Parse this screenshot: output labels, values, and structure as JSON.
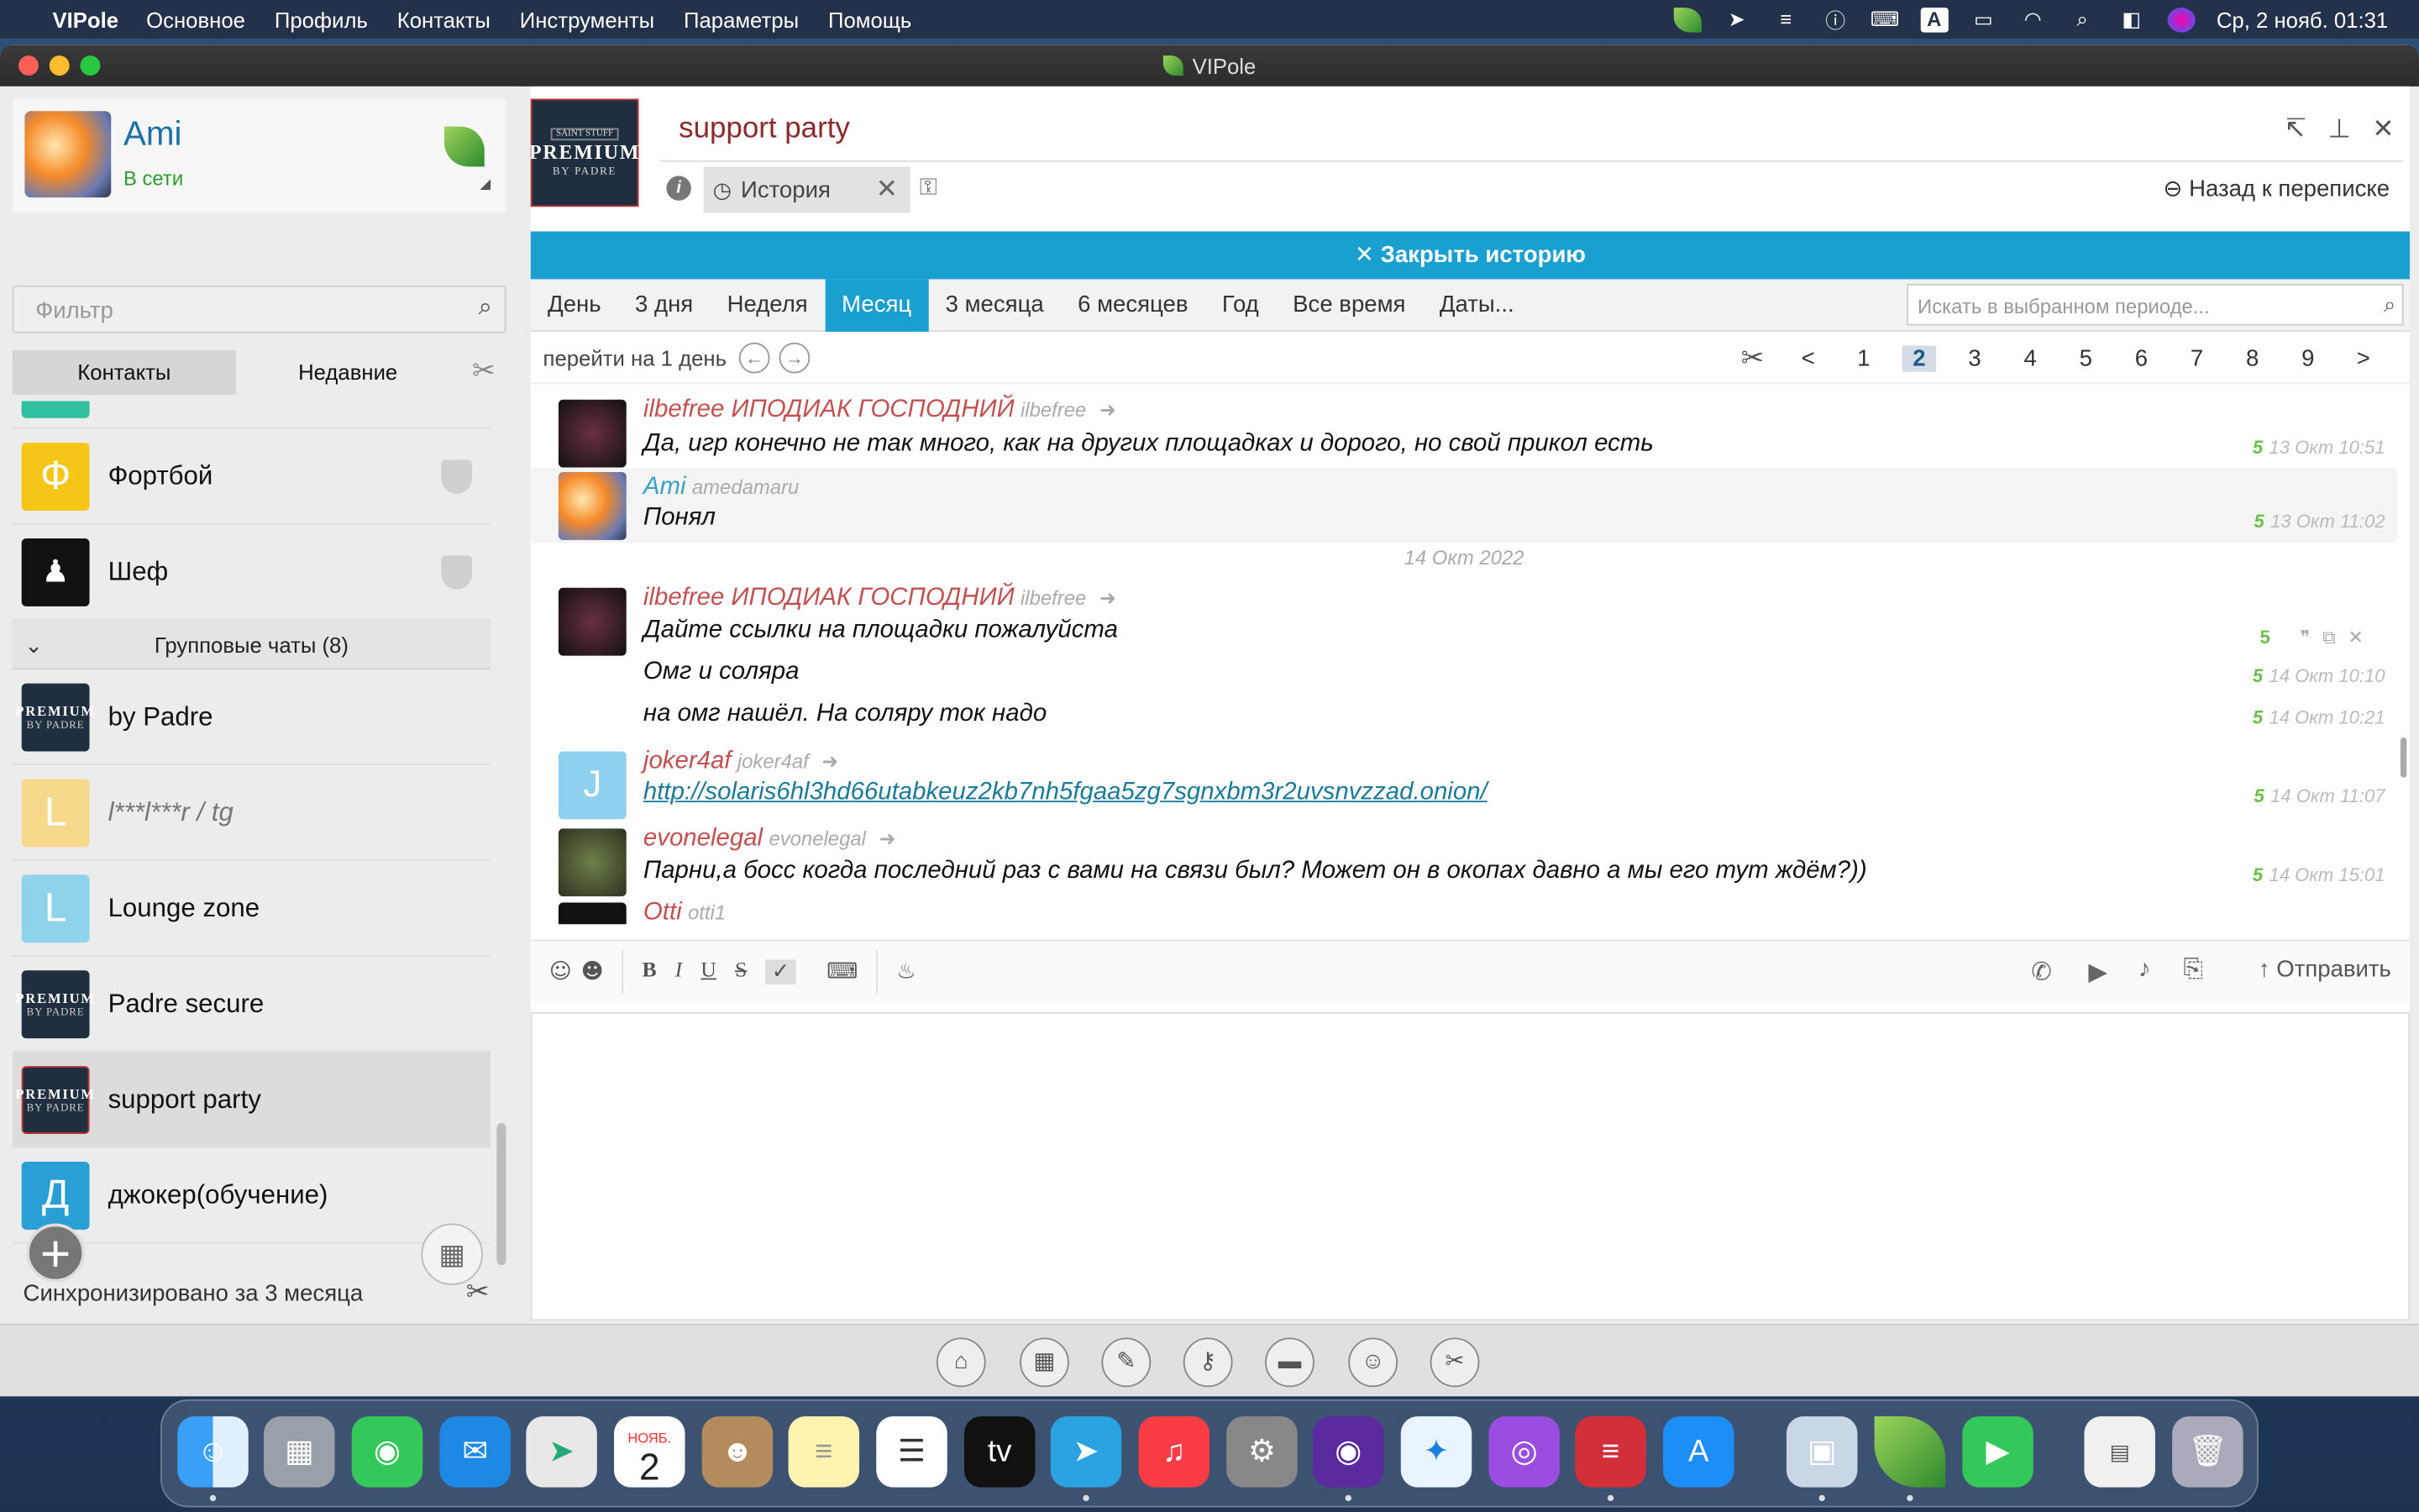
{
  "menubar": {
    "app_name": "VIPole",
    "items": [
      "Основное",
      "Профиль",
      "Контакты",
      "Инструменты",
      "Параметры",
      "Помощь"
    ],
    "clock": "Ср, 2 нояб.  01:31"
  },
  "window": {
    "title": "VIPole"
  },
  "profile": {
    "name": "Ami",
    "status": "В сети"
  },
  "filter": {
    "placeholder": "Фильтр"
  },
  "tabs": {
    "contacts": "Контакты",
    "recent": "Недавние"
  },
  "contacts": [
    {
      "name": "Фортбой",
      "avatar_letter": "Ф",
      "color": "#f5c518"
    },
    {
      "name": "Шеф",
      "avatar_letter": "",
      "color": "#111111"
    }
  ],
  "group_header": "Групповые чаты (8)",
  "groups": [
    {
      "name": "by Padre",
      "type": "premium"
    },
    {
      "name": "l***l***r / tg",
      "avatar_letter": "L",
      "color": "#f6d98a",
      "italic": true
    },
    {
      "name": "Lounge zone",
      "avatar_letter": "L",
      "color": "#8fd3ea"
    },
    {
      "name": "Padre secure",
      "type": "premium"
    },
    {
      "name": "support party",
      "type": "premium",
      "selected": true
    },
    {
      "name": "джокер(обучение)",
      "avatar_letter": "Д",
      "color": "#2a9fd6"
    }
  ],
  "premium_logo": {
    "top": "SAINT STUFF",
    "main": "PREMIUM",
    "bottom": "BY PADRE"
  },
  "sync_text": "Синхронизировано за 3 месяца",
  "chat": {
    "title": "support party",
    "history_tab": "История",
    "back": "Назад к переписке",
    "close_history": "✕ Закрыть историю",
    "periods": [
      "День",
      "3 дня",
      "Неделя",
      "Месяц",
      "3 месяца",
      "6 месяцев",
      "Год",
      "Все время",
      "Даты..."
    ],
    "active_period": "Месяц",
    "search_placeholder": "Искать в выбранном периоде...",
    "goto_label": "перейти на 1 день",
    "pages": [
      "<",
      "1",
      "2",
      "3",
      "4",
      "5",
      "6",
      "7",
      "8",
      "9",
      ">"
    ],
    "active_page": "2"
  },
  "messages": [
    {
      "nick": "ilbefree  ИПОДИАК ГОСПОДНИЙ",
      "login": "ilbefree",
      "text": "Да, игр конечно не так много, как на других площадках и дорого, но свой прикол есть",
      "time": "13 Окт 10:51"
    },
    {
      "nick": "Ami",
      "login": "amedamaru",
      "text": "Понял",
      "time": "13 Окт 11:02"
    },
    {
      "date": "14 Окт 2022"
    },
    {
      "nick": "ilbefree  ИПОДИАК ГОСПОДНИЙ",
      "login": "ilbefree",
      "text": "Дайте ссылки на площадки пожалуйста"
    },
    {
      "text": "Омг и соляра",
      "time": "14 Окт 10:10"
    },
    {
      "text": "на омг нашёл. На соляру ток надо",
      "time": "14 Окт 10:21"
    },
    {
      "nick": "joker4af",
      "login": "joker4af",
      "text": "http://solaris6hl3hd66utabkeuz2kb7nh5fgaa5zg7sgnxbm3r2uvsnvzzad.onion/",
      "time": "14 Окт 11:07"
    },
    {
      "nick": "evonelegal",
      "login": "evonelegal",
      "text": "Парни,а босс когда последний раз с вами на связи был? Может он в окопах давно  а мы его тут ждём?))",
      "time": "14 Окт 15:01"
    },
    {
      "nick": "Otti",
      "login": "otti1"
    }
  ],
  "read_count": "5",
  "compose": {
    "send": "Отправить",
    "bold": "B",
    "italic": "I",
    "underline": "U",
    "strike": "S"
  },
  "month_badge": "НОЯБ.",
  "day_badge": "2",
  "avatar_letter_j": "J"
}
